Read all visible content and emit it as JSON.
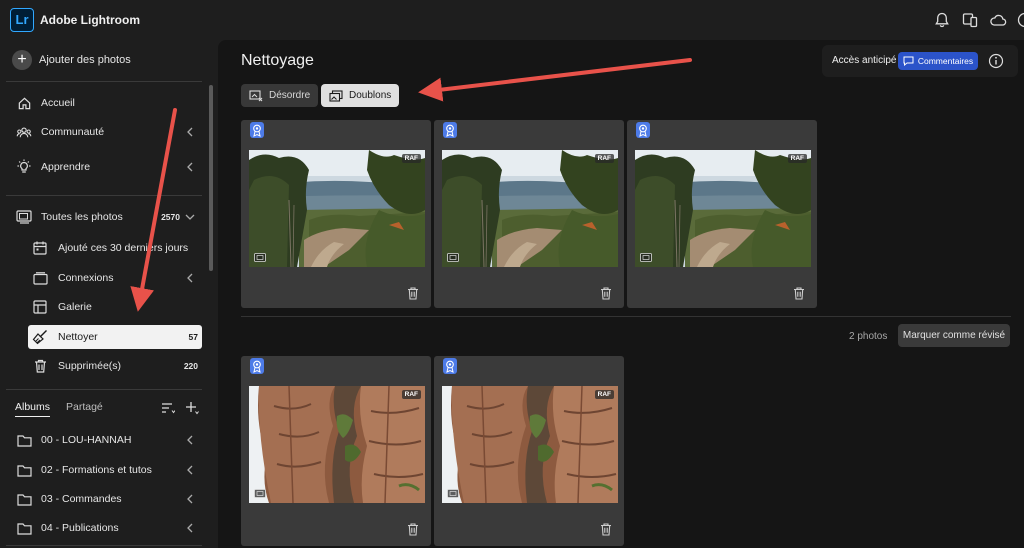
{
  "app": {
    "logo": "Lr",
    "title": "Adobe Lightroom"
  },
  "topbar_icons": [
    "bell-icon",
    "devices-icon",
    "cloud-icon",
    "help-icon"
  ],
  "sidebar": {
    "add_photos": "Ajouter des photos",
    "nav": [
      {
        "label": "Accueil",
        "icon": "home-icon"
      },
      {
        "label": "Communauté",
        "icon": "community-icon"
      },
      {
        "label": "Apprendre",
        "icon": "bulb-icon"
      }
    ],
    "all_photos": {
      "label": "Toutes les photos",
      "count": "2570"
    },
    "sub": [
      {
        "label": "Ajouté ces 30 derniers jours",
        "icon": "calendar-icon"
      },
      {
        "label": "Connexions",
        "icon": "connections-icon"
      },
      {
        "label": "Galerie",
        "icon": "gallery-icon"
      },
      {
        "label": "Nettoyer",
        "icon": "broom-icon",
        "count": "57"
      },
      {
        "label": "Supprimée(s)",
        "icon": "trash-icon",
        "count": "220"
      }
    ],
    "tabs": {
      "albums": "Albums",
      "shared": "Partagé"
    },
    "albums": [
      {
        "label": "00 - LOU-HANNAH"
      },
      {
        "label": "02 - Formations et tutos"
      },
      {
        "label": "03 - Commandes"
      },
      {
        "label": "04 - Publications"
      }
    ]
  },
  "main": {
    "title": "Nettoyage",
    "filters": {
      "clutter": "Désordre",
      "duplicates": "Doublons"
    },
    "early_access": {
      "label": "Accès anticipé",
      "comments": "Commentaires"
    },
    "groups": [
      {
        "photos": [
          {
            "format": "RAF"
          },
          {
            "format": "RAF"
          },
          {
            "format": "RAF"
          }
        ]
      },
      {
        "count_label": "2 photos",
        "action": "Marquer comme révisé",
        "photos": [
          {
            "format": "RAF"
          },
          {
            "format": "RAF"
          }
        ]
      }
    ]
  },
  "colors": {
    "accent_blue": "#2b53c9",
    "badge_blue": "#4d7be8",
    "annotation_arrow": "#e8524a",
    "logo_blue": "#31a8ff"
  }
}
